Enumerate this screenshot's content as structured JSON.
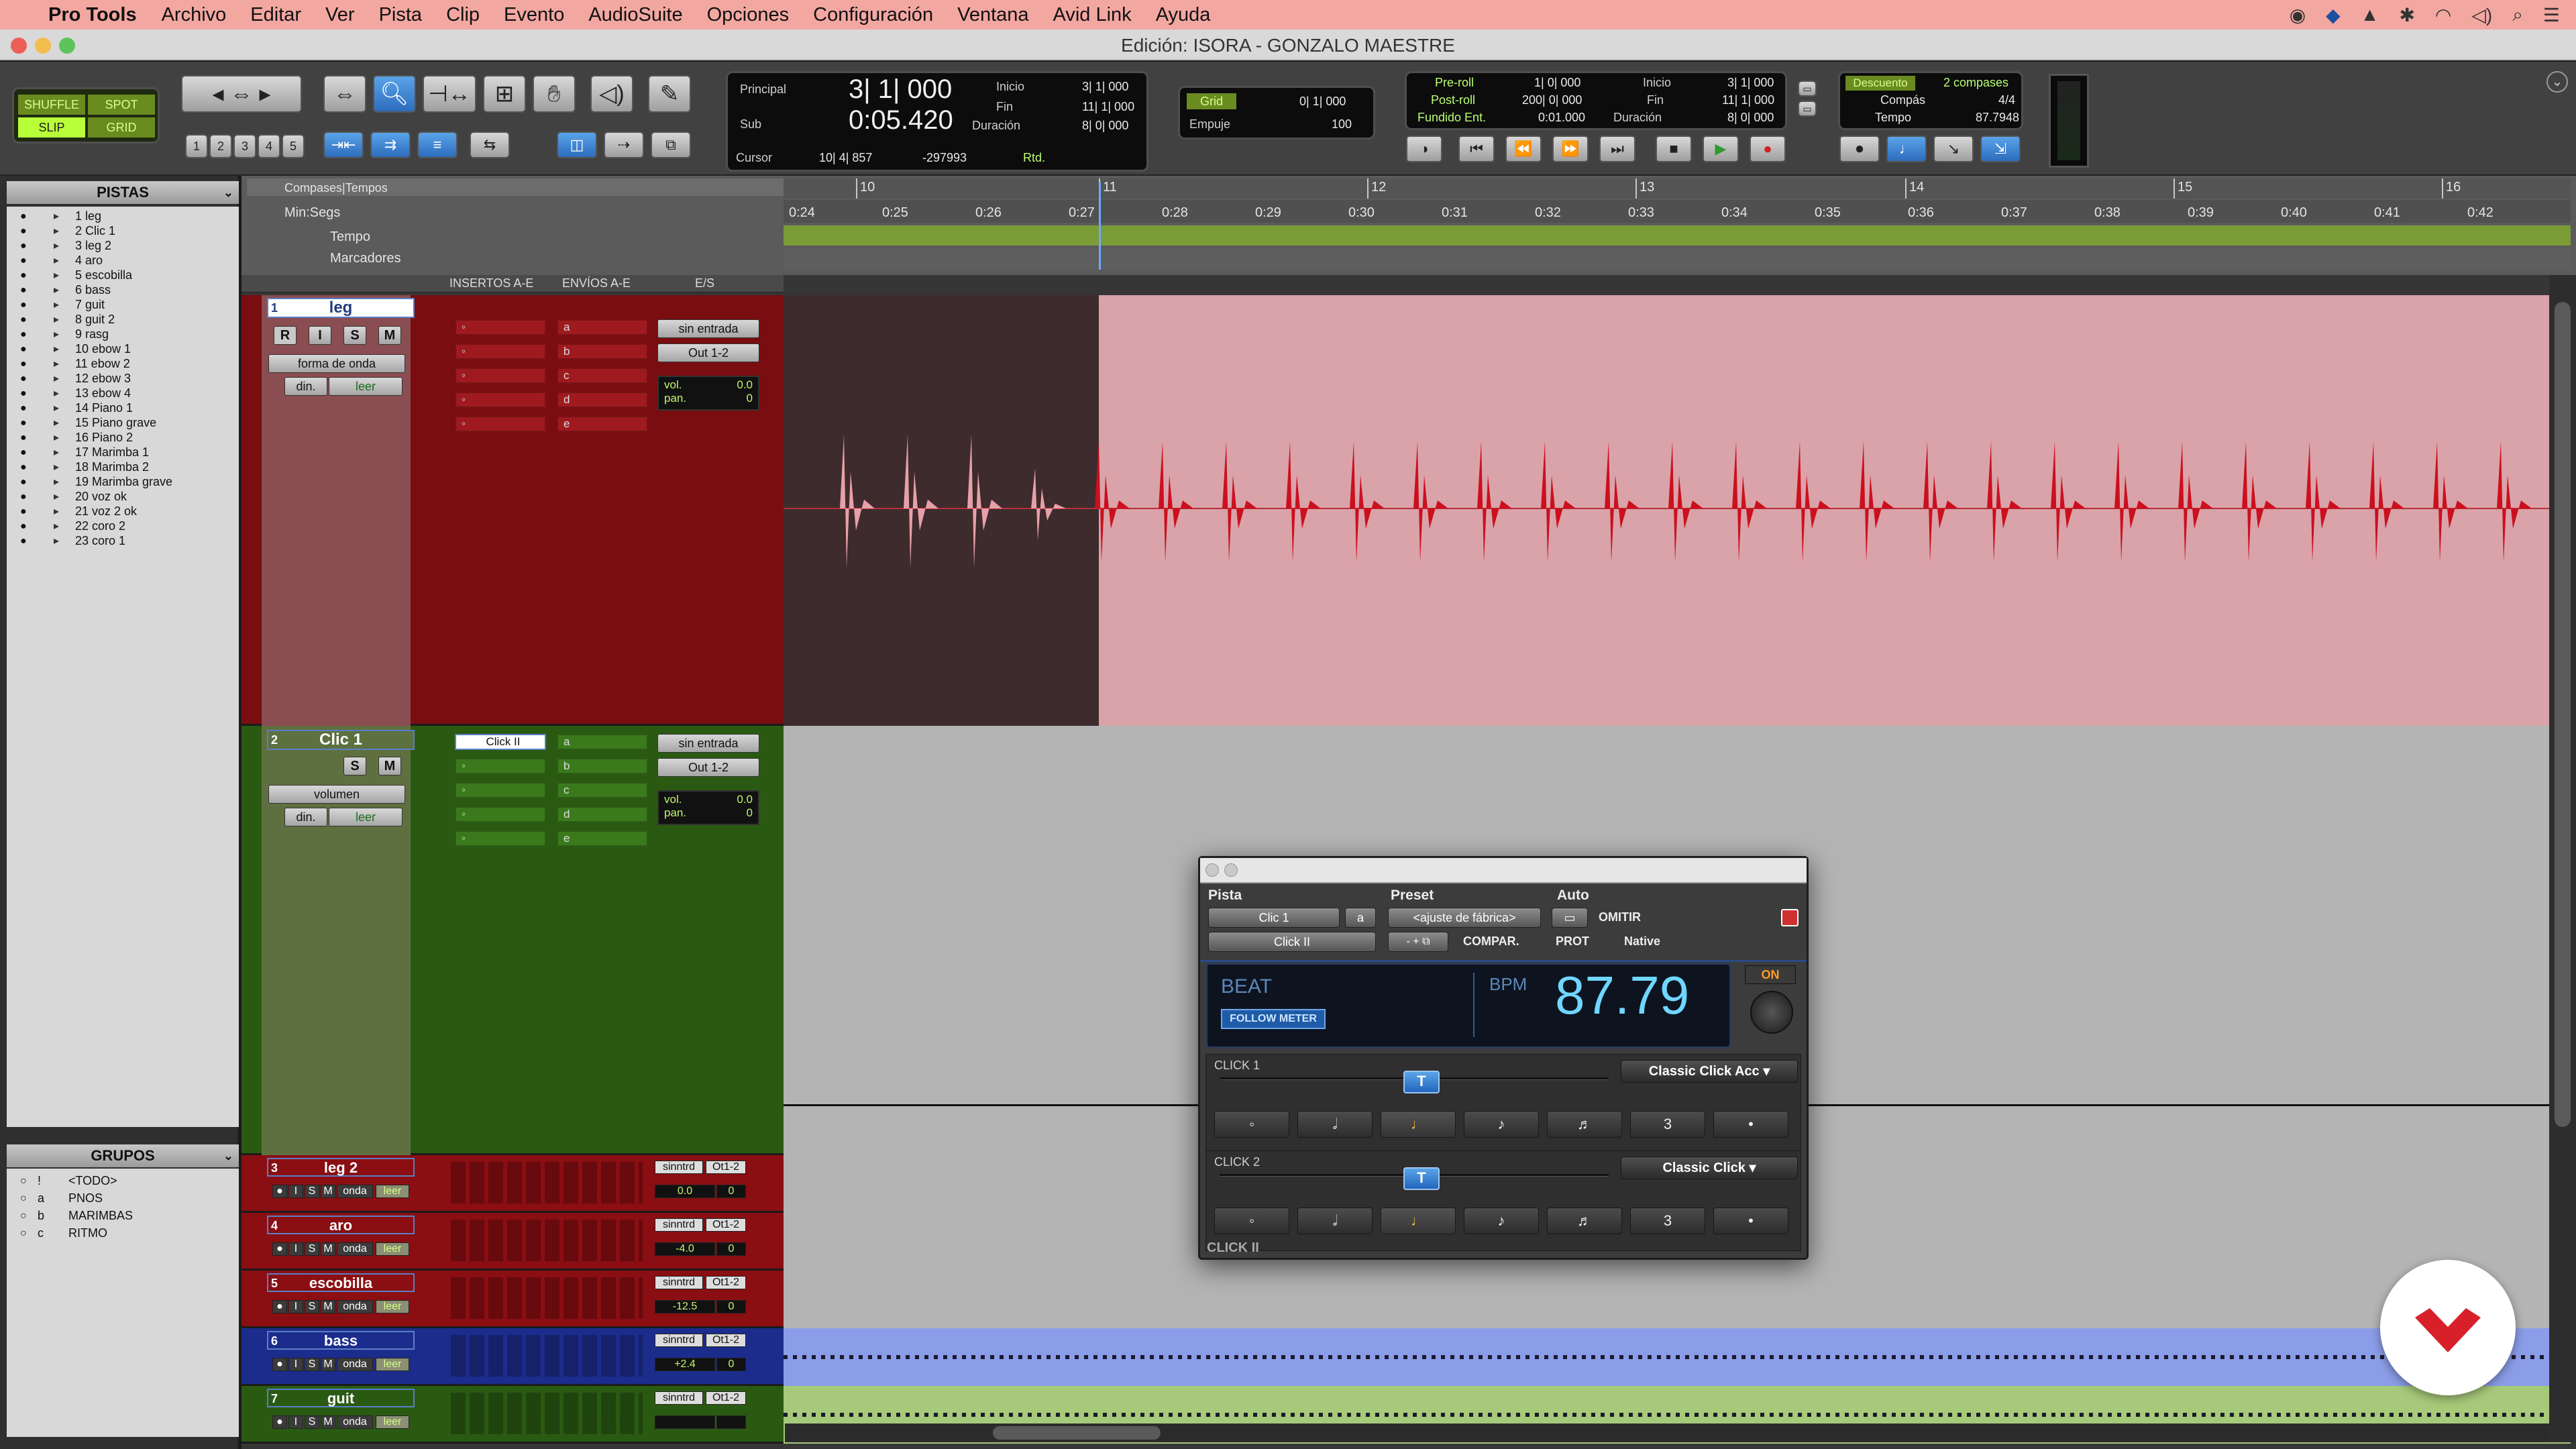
{
  "menubar": {
    "app": "Pro Tools",
    "items": [
      "Archivo",
      "Editar",
      "Ver",
      "Pista",
      "Clip",
      "Evento",
      "AudioSuite",
      "Opciones",
      "Configuración",
      "Ventana",
      "Avid Link",
      "Ayuda"
    ],
    "status_icons": [
      "creative-cloud-icon",
      "avid-icon",
      "record-icon",
      "bluetooth-icon",
      "wifi-icon",
      "volume-icon",
      "search-icon",
      "menu-list-icon"
    ]
  },
  "window": {
    "title": "Edición: ISORA - GONZALO MAESTRE"
  },
  "toolbar": {
    "modes": {
      "shuffle": "SHUFFLE",
      "spot": "SPOT",
      "slip": "SLIP",
      "grid": "GRID"
    },
    "zoom_presets": [
      "1",
      "2",
      "3",
      "4",
      "5"
    ],
    "counter": {
      "main_label": "Principal",
      "main_value": "3| 1| 000",
      "sub_label": "Sub",
      "sub_value": "0:05.420",
      "start_label": "Inicio",
      "start_value": "3| 1| 000",
      "end_label": "Fin",
      "end_value": "11| 1| 000",
      "length_label": "Duración",
      "length_value": "8| 0| 000",
      "cursor_label": "Cursor",
      "cursor_value": "10| 4| 857",
      "cursor_sample": "-297993",
      "rtd_label": "Rtd."
    },
    "grid": {
      "label": "Grid",
      "value": "0| 1| 000",
      "nudge_label": "Empuje",
      "nudge_value": "100"
    },
    "preroll": {
      "preroll_label": "Pre-roll",
      "preroll_value": "1| 0| 000",
      "postroll_label": "Post-roll",
      "postroll_value": "200| 0| 000",
      "fade_label": "Fundido Ent.",
      "fade_value": "0:01.000",
      "start_label": "Inicio",
      "start_value": "3| 1| 000",
      "end_label": "Fin",
      "end_value": "11| 1| 000",
      "length_label": "Duración",
      "length_value": "8| 0| 000"
    },
    "countoff": {
      "countoff_label": "Descuento",
      "countoff_value": "2 compases",
      "meter_label": "Compás",
      "meter_value": "4/4",
      "tempo_label": "Tempo",
      "tempo_value": "87.7948"
    },
    "transport_icons": [
      "online-icon",
      "return-to-zero-icon",
      "rewind-icon",
      "fast-forward-icon",
      "go-to-end-icon",
      "stop-icon",
      "play-icon",
      "record-icon"
    ]
  },
  "tracks_list": {
    "header": "PISTAS",
    "items": [
      "1 leg",
      "2 Clic 1",
      "3 leg 2",
      "4 aro",
      "5 escobilla",
      "6 bass",
      "7 guit",
      "8 guit 2",
      "9 rasg",
      "10 ebow 1",
      "11 ebow 2",
      "12 ebow 3",
      "13 ebow 4",
      "14 Piano 1",
      "15 Piano grave",
      "16 Piano 2",
      "17 Marimba 1",
      "18 Marimba 2",
      "19 Marimba grave",
      "20 voz ok",
      "21 voz 2 ok",
      "22 coro 2",
      "23 coro 1"
    ]
  },
  "groups_list": {
    "header": "GRUPOS",
    "items": [
      {
        "id": "!",
        "name": "<TODO>"
      },
      {
        "id": "a",
        "name": "PNOS"
      },
      {
        "id": "b",
        "name": "MARIMBAS"
      },
      {
        "id": "c",
        "name": "RITMO"
      }
    ]
  },
  "rulers": {
    "labels": [
      "Compases|Tempos",
      "Min:Segs",
      "Tempo",
      "Marcadores"
    ],
    "bars": [
      "10",
      "11",
      "12",
      "13",
      "14",
      "15",
      "16"
    ],
    "minsecs": [
      "0:24",
      "0:25",
      "0:26",
      "0:27",
      "0:28",
      "0:29",
      "0:30",
      "0:31",
      "0:32",
      "0:33",
      "0:34",
      "0:35",
      "0:36",
      "0:37",
      "0:38",
      "0:39",
      "0:40",
      "0:41",
      "0:42"
    ]
  },
  "edit_columns": {
    "inserts": "INSERTOS A-E",
    "sends": "ENVÍOS A-E",
    "io": "E/S"
  },
  "tracks": [
    {
      "num": "1",
      "name": "leg",
      "view": "forma de onda",
      "auto_mode_label": "din.",
      "auto_mode": "leer",
      "sends": [
        "a",
        "b",
        "c",
        "d",
        "e"
      ],
      "input": "sin entrada",
      "output": "Out 1-2",
      "vol_label": "vol.",
      "vol": "0.0",
      "pan_label": "pan.",
      "pan": "0",
      "buttons": [
        "R",
        "I",
        "S",
        "M"
      ]
    },
    {
      "num": "2",
      "name": "Clic 1",
      "view": "volumen",
      "auto_mode_label": "din.",
      "auto_mode": "leer",
      "insert": "Click II",
      "sends": [
        "a",
        "b",
        "c",
        "d",
        "e"
      ],
      "input": "sin entrada",
      "output": "Out 1-2",
      "vol_label": "vol.",
      "vol": "0.0",
      "pan_label": "pan.",
      "pan": "0",
      "buttons": [
        "S",
        "M"
      ]
    }
  ],
  "mini_tracks": [
    {
      "num": "3",
      "name": "leg 2",
      "in": "sinntrd",
      "out": "Ot1-2",
      "vol": "0.0",
      "pan": "0",
      "color": "#8a0e12"
    },
    {
      "num": "4",
      "name": "aro",
      "in": "sinntrd",
      "out": "Ot1-2",
      "vol": "-4.0",
      "pan": "0",
      "color": "#8a0e12"
    },
    {
      "num": "5",
      "name": "escobilla",
      "in": "sinntrd",
      "out": "Ot1-2",
      "vol": "-12.5",
      "pan": "0",
      "color": "#8a0e12"
    },
    {
      "num": "6",
      "name": "bass",
      "in": "sinntrd",
      "out": "Ot1-2",
      "vol": "+2.4",
      "pan": "0",
      "color": "#1c2c8c"
    },
    {
      "num": "7",
      "name": "guit",
      "in": "sinntrd",
      "out": "Ot1-2",
      "vol": "",
      "pan": "",
      "color": "#2a5a12"
    }
  ],
  "mini_track_labels": {
    "view": "onda",
    "mode": "leer",
    "r": "I",
    "s": "S",
    "m": "M"
  },
  "plugin": {
    "track_label": "Pista",
    "preset_label": "Preset",
    "auto_label": "Auto",
    "track_name": "Clic 1",
    "track_sel": "a",
    "plugin_name": "Click II",
    "preset_value": "<ajuste de fábrica>",
    "compare": "COMPAR.",
    "bypass": "OMITIR",
    "protect": "PROT",
    "format": "Native",
    "beat_label": "BEAT",
    "follow_meter": "FOLLOW METER",
    "bpm_label": "BPM",
    "bpm_value": "87.79",
    "on_label": "ON",
    "click1_label": "CLICK 1",
    "click1_sound": "Classic Click Acc",
    "click2_label": "CLICK 2",
    "click2_sound": "Classic Click",
    "note_buttons": [
      "◦",
      "𝅗𝅥",
      "♩",
      "♪",
      "♬",
      "3",
      "•"
    ],
    "footer": "CLICK II"
  },
  "colors": {
    "accent": "#2d6cbd",
    "track_red": "#8a0e12",
    "track_green": "#2a5a12",
    "track_blue": "#1c2c8c",
    "clip_pink": "#d8a3a8",
    "wave_red": "#cc0f1e"
  }
}
